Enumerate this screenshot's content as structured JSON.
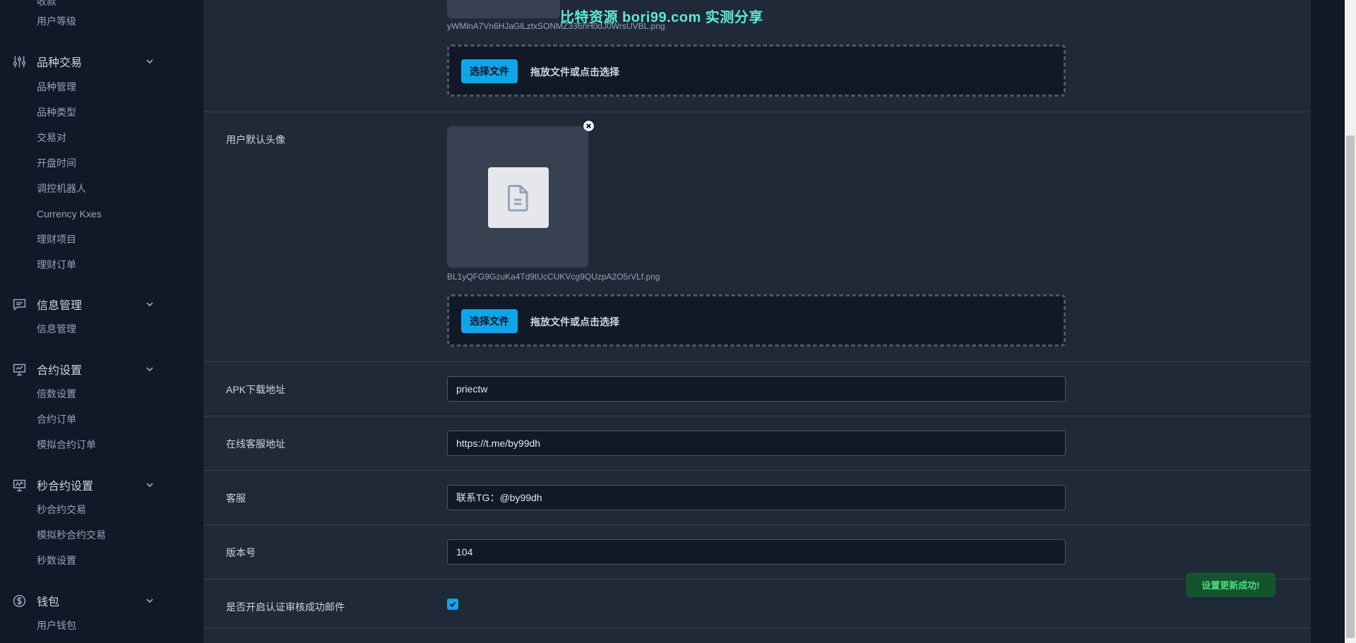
{
  "sidebar": {
    "cut_item": "收款",
    "top_item": "用户等级",
    "groups": [
      {
        "label": "品种交易",
        "items": [
          "品种管理",
          "品种类型",
          "交易对",
          "开盘时间",
          "调控机器人",
          "Currency Kxes",
          "理财项目",
          "理财订单"
        ]
      },
      {
        "label": "信息管理",
        "items": [
          "信息管理"
        ]
      },
      {
        "label": "合约设置",
        "items": [
          "倍数设置",
          "合约订单",
          "模拟合约订单"
        ]
      },
      {
        "label": "秒合约设置",
        "items": [
          "秒合约交易",
          "模拟秒合约交易",
          "秒数设置"
        ]
      },
      {
        "label": "钱包",
        "items": [
          "用户钱包"
        ]
      }
    ]
  },
  "main": {
    "top_file": {
      "filename": "yWMlnA7Vn6HJaGlLztxSONMZ336nH0dJ0WrsUVBL.png",
      "choose_label": "选择文件",
      "drop_text": "拖放文件或点击选择"
    },
    "avatar": {
      "label": "用户默认头像",
      "filename": "BL1yQFG9GzuKa4Td9tUcCUKVcg9QUzpA2O5rVLf.png",
      "choose_label": "选择文件",
      "drop_text": "拖放文件或点击选择"
    },
    "fields": [
      {
        "label": "APK下载地址",
        "value": "priectw"
      },
      {
        "label": "在线客服地址",
        "value": "https://t.me/by99dh"
      },
      {
        "label": "客服",
        "value": "联系TG：@by99dh"
      },
      {
        "label": "版本号",
        "value": "104"
      }
    ],
    "checkbox_field": {
      "label": "是否开启认证审核成功邮件",
      "checked": true
    }
  },
  "toast": {
    "text": "设置更新成功!"
  },
  "watermark": {
    "text": "比特资源 bori99.com 实测分享"
  },
  "colors": {
    "accent": "#0ea5e9",
    "sidebar_bg": "#111827",
    "main_bg": "#1f2937",
    "toast_bg": "#14532d",
    "toast_text": "#4ade80",
    "watermark": "#5eead4"
  }
}
